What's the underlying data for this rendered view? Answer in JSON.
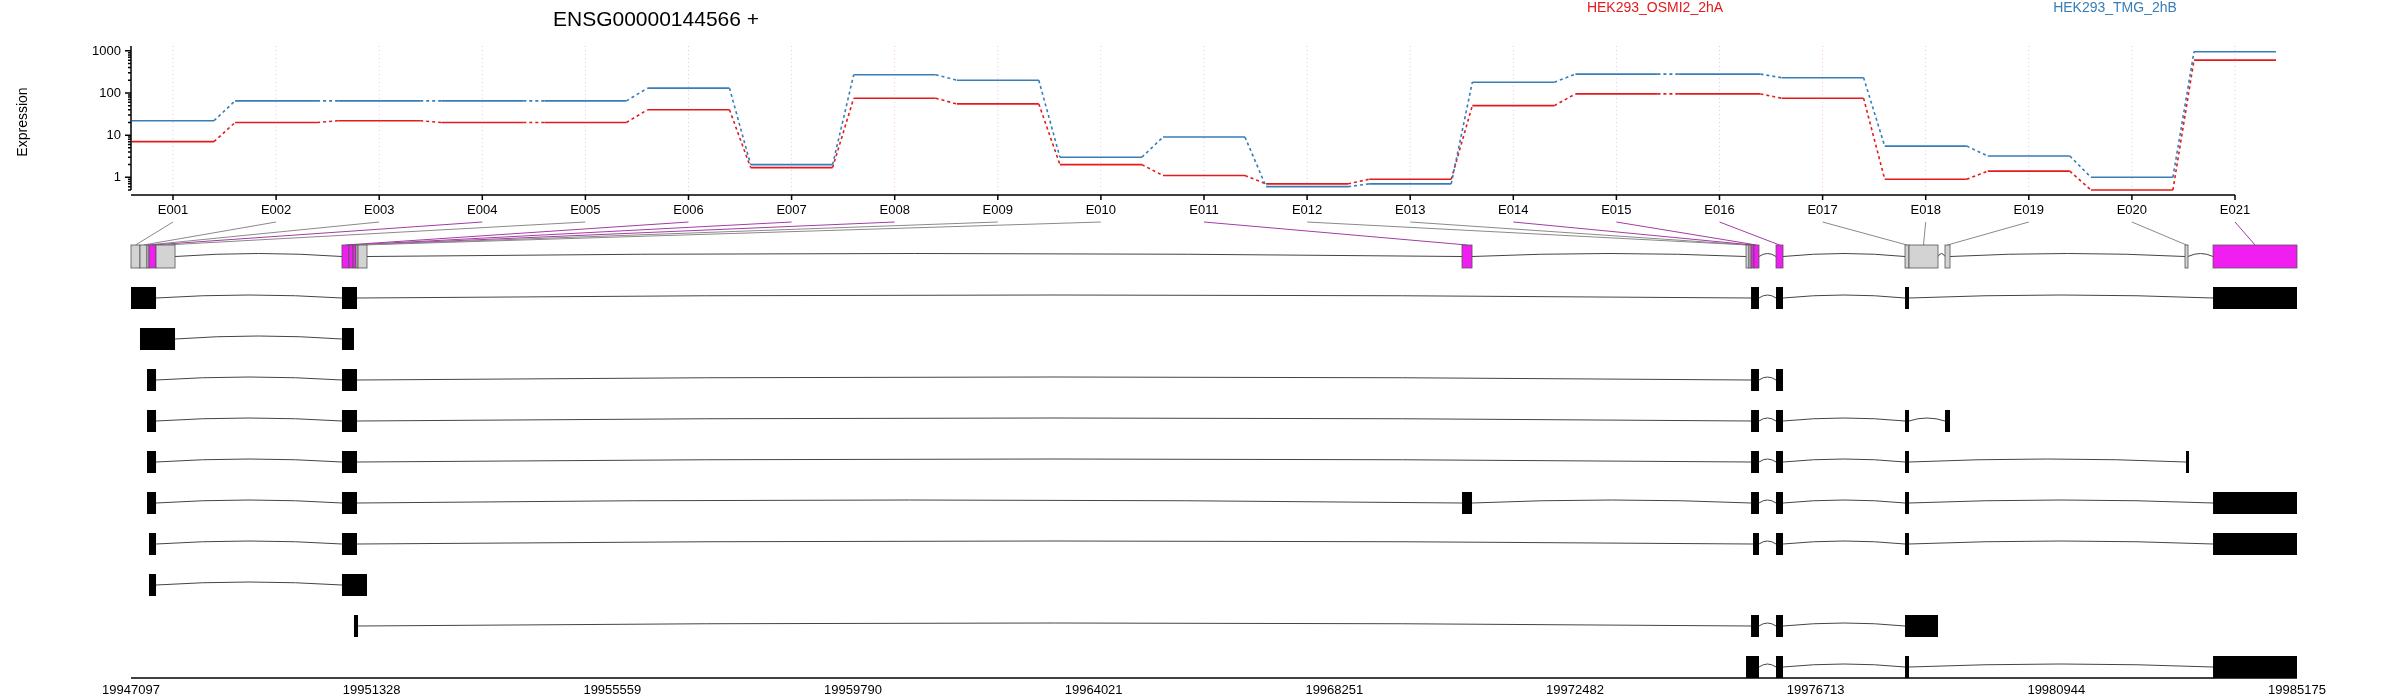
{
  "expression": {
    "title": "ENSG00000144566 +",
    "legend": [
      {
        "name": "HEK293_OSMI2_2hA",
        "color": "#e41a1c"
      },
      {
        "name": "HEK293_TMG_2hB",
        "color": "#377eb8"
      }
    ],
    "y_axis_title": "Expression",
    "y_axis_labels": [
      "1000",
      "100",
      "10",
      "1"
    ],
    "exon_labels": [
      "E001",
      "E002",
      "E003",
      "E004",
      "E005",
      "E006",
      "E007",
      "E008",
      "E009",
      "E010",
      "E011",
      "E012",
      "E013",
      "E014",
      "E015",
      "E016",
      "E017",
      "E018",
      "E019",
      "E020",
      "E021"
    ]
  },
  "gene_model": {
    "xticks": [
      "19947097",
      "19951328",
      "19955559",
      "19959790",
      "19964021",
      "19968251",
      "19972482",
      "19976713",
      "19980944",
      "19985175"
    ],
    "exon_bins": [
      {
        "significant": false
      },
      {
        "significant": false
      },
      {
        "significant": false
      },
      {
        "significant": true
      },
      {
        "significant": false
      },
      {
        "significant": true
      },
      {
        "significant": true
      },
      {
        "significant": true
      },
      {
        "significant": false
      },
      {
        "significant": false
      },
      {
        "significant": true
      },
      {
        "significant": false
      },
      {
        "significant": false
      },
      {
        "significant": true
      },
      {
        "significant": true
      },
      {
        "significant": true
      },
      {
        "significant": false
      },
      {
        "significant": false
      },
      {
        "significant": false
      },
      {
        "significant": false
      },
      {
        "significant": true
      }
    ]
  }
}
